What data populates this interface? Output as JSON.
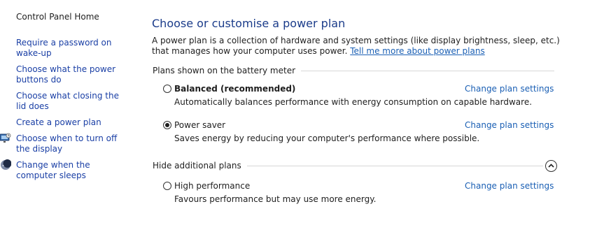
{
  "sidebar": {
    "home": "Control Panel Home",
    "links": [
      {
        "label": "Require a password on wake-up"
      },
      {
        "label": "Choose what the power buttons do"
      },
      {
        "label": "Choose what closing the lid does"
      },
      {
        "label": "Create a power plan"
      },
      {
        "label": "Choose when to turn off the display",
        "icon": "display-icon"
      },
      {
        "label": "Change when the computer sleeps",
        "icon": "sleep-moon-icon"
      }
    ]
  },
  "main": {
    "title": "Choose or customise a power plan",
    "intro": "A power plan is a collection of hardware and system settings (like display brightness, sleep, etc.) that manages how your computer uses power.",
    "intro_link": "Tell me more about power plans",
    "battery_section": {
      "label": "Plans shown on the battery meter",
      "plans": [
        {
          "name": "Balanced (recommended)",
          "description": "Automatically balances performance with energy consumption on capable hardware.",
          "link": "Change plan settings",
          "selected": false
        },
        {
          "name": "Power saver",
          "description": "Saves energy by reducing your computer's performance where possible.",
          "link": "Change plan settings",
          "selected": true
        }
      ]
    },
    "additional_section": {
      "label": "Hide additional plans",
      "toggle_icon": "chevron-up-icon",
      "plans": [
        {
          "name": "High performance",
          "description": "Favours performance but may use more energy.",
          "link": "Change plan settings",
          "selected": false
        }
      ]
    }
  },
  "colors": {
    "title": "#1b3c8a",
    "link": "#1a5fb4",
    "sidebar_link": "#1a3fa5",
    "divider": "#d7d7d7"
  }
}
